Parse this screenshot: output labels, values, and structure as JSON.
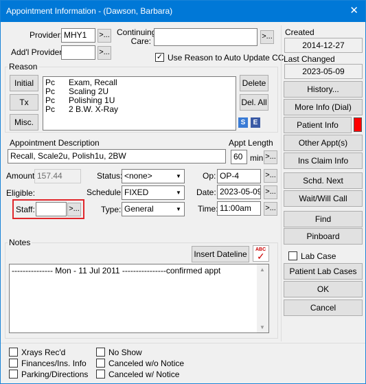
{
  "window": {
    "title": "Appointment Information - (Dawson, Barbara)",
    "close": "✕"
  },
  "provider": {
    "label": "Provider:",
    "value": "MHY1",
    "hyg_label": "Add'l Provider:",
    "hyg_value": "",
    "more": ">..."
  },
  "continuing_care": {
    "label": "Continuing Care:",
    "value": "",
    "use_reason_label": "Use Reason to Auto Update CC",
    "checked": "✓"
  },
  "reason": {
    "title": "Reason",
    "initial": "Initial",
    "tx": "Tx",
    "misc": "Misc.",
    "delete": "Delete",
    "del_all": "Del. All",
    "items": [
      {
        "code": "Pc",
        "desc": "Exam, Recall"
      },
      {
        "code": "Pc",
        "desc": "Scaling 2U"
      },
      {
        "code": "Pc",
        "desc": "Polishing 1U"
      },
      {
        "code": "Pc",
        "desc": "2 B.W. X-Ray"
      }
    ],
    "icon_s": "S",
    "icon_e": "E"
  },
  "appt_desc": {
    "label": "Appointment Description",
    "value": "Recall, Scale2u, Polish1u, 2BW"
  },
  "appt_length": {
    "label": "Appt Length",
    "value": "60",
    "unit": "min",
    "more": ">..."
  },
  "amount": {
    "label": "Amount:",
    "value": "157.44"
  },
  "eligible": {
    "label": "Eligible:"
  },
  "staff": {
    "label": "Staff:",
    "value": "",
    "more": ">..."
  },
  "status": {
    "label": "Status:",
    "value": "<none>"
  },
  "schedule": {
    "label": "Schedule:",
    "value": "FIXED"
  },
  "type": {
    "label": "Type:",
    "value": "General"
  },
  "op": {
    "label": "Op:",
    "value": "OP-4",
    "more": ">..."
  },
  "date": {
    "label": "Date:",
    "value": "2023-05-09",
    "more": ">..."
  },
  "time": {
    "label": "Time:",
    "value": "11:00am",
    "more": ">..."
  },
  "notes": {
    "title": "Notes",
    "insert_dateline": "Insert Dateline",
    "text": "--------------- Mon - 11 Jul 2011 ----------------confirmed appt",
    "spell": "ABC"
  },
  "right": {
    "created_label": "Created",
    "created": "2014-12-27",
    "changed_label": "Last Changed",
    "changed": "2023-05-09",
    "history": "History...",
    "more_info": "More Info (Dial)",
    "patient_info": "Patient Info",
    "other_appts": "Other Appt(s)",
    "ins_claim": "Ins Claim Info",
    "schd_next": "Schd. Next",
    "wait_call": "Wait/Will Call",
    "find": "Find",
    "pinboard": "Pinboard",
    "lab_case": "Lab Case",
    "patient_lab_cases": "Patient Lab Cases",
    "ok": "OK",
    "cancel": "Cancel",
    "patient_info_color": "#ff0000"
  },
  "flags": {
    "xrays": "Xrays Rec'd",
    "finances": "Finances/Ins. Info",
    "parking": "Parking/Directions",
    "no_show": "No Show",
    "canceled_wo": "Canceled w/o Notice",
    "canceled_w": "Canceled w/ Notice"
  }
}
